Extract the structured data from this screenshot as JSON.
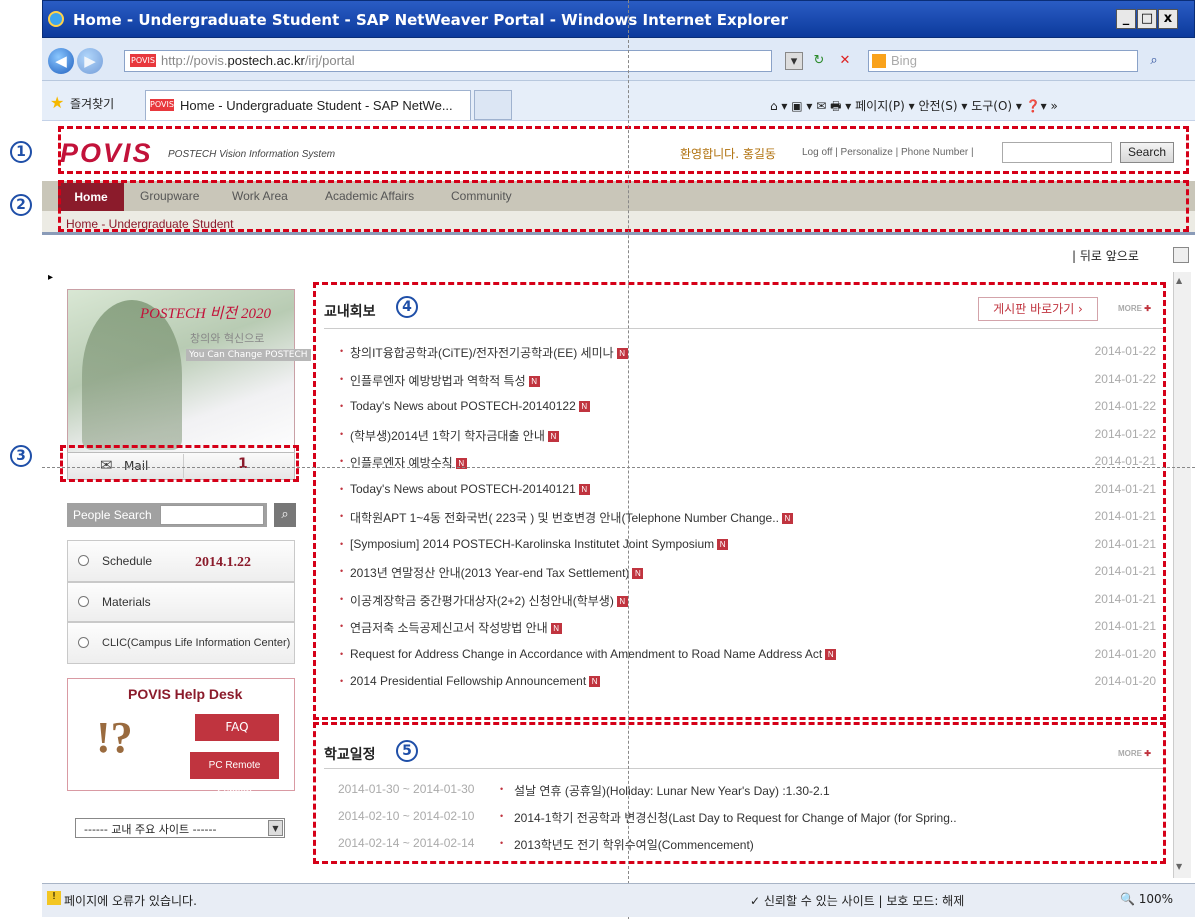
{
  "window": {
    "title": "Home - Undergraduate Student - SAP NetWeaver Portal - Windows Internet Explorer",
    "minimize": "_",
    "restore": "□",
    "close": "x"
  },
  "browser": {
    "back_glyph": "◀",
    "forward_glyph": "▶",
    "address_prefix": "http://povis.",
    "address_host": "postech.ac.kr",
    "address_suffix": "/irj/portal",
    "address_logo": "POVIS",
    "search_placeholder": "Bing",
    "favorites_label": "즐겨찾기",
    "tab_title": "Home - Undergraduate Student - SAP NetWe...",
    "command_bar": "⌂ ▾ ▣ ▾ ✉ 🖶 ▾  페이지(P) ▾  안전(S) ▾  도구(O) ▾  ❓▾ »",
    "back_forward": "| 뒤로  앞으로"
  },
  "portal": {
    "logo": "POVIS",
    "logo_sub": "POSTECH Vision Information System",
    "welcome": "환영합니다. 홍길동",
    "top_links": "Log off | Personalize | Phone Number |",
    "search_button": "Search",
    "nav": [
      "Home",
      "Groupware",
      "Work Area",
      "Academic Affairs",
      "Community"
    ],
    "breadcrumb": "Home - Undergraduate Student"
  },
  "left": {
    "banner_title": "POSTECH 비전 2020",
    "banner_sub": "창의와 혁신으로",
    "banner_en": "You Can Change POSTECH",
    "mail_label": "Mail",
    "mail_count": "1",
    "people_search": "People Search",
    "items": [
      "Schedule",
      "Materials",
      "CLIC(Campus Life Information Center)"
    ],
    "schedule_date": "2014.1.22",
    "helpdesk_title": "POVIS Help Desk",
    "faq": "FAQ",
    "pc_remote": "PC Remote Support",
    "site_select": "------ 교내 주요 사이트 ------"
  },
  "news": {
    "title": "교내회보",
    "board_button": "게시판 바로가기 ›",
    "more": "MORE",
    "items": [
      {
        "text": "창의IT융합공학과(CiTE)/전자전기공학과(EE) 세미나",
        "date": "2014-01-22"
      },
      {
        "text": "인플루엔자 예방방법과 역학적 특성",
        "date": "2014-01-22"
      },
      {
        "text": "Today's News about POSTECH-20140122",
        "date": "2014-01-22"
      },
      {
        "text": "(학부생)2014년 1학기 학자금대출 안내",
        "date": "2014-01-22"
      },
      {
        "text": "인플루엔자 예방수칙",
        "date": "2014-01-21"
      },
      {
        "text": "Today's News about POSTECH-20140121",
        "date": "2014-01-21"
      },
      {
        "text": "대학원APT 1~4동 전화국번( 223국 ) 및 번호변경 안내(Telephone Number Change..",
        "date": "2014-01-21"
      },
      {
        "text": "[Symposium] 2014 POSTECH-Karolinska Institutet Joint Symposium",
        "date": "2014-01-21"
      },
      {
        "text": "2013년 연말정산 안내(2013 Year-end Tax Settlement)",
        "date": "2014-01-21"
      },
      {
        "text": "이공계장학금 중간평가대상자(2+2) 신청안내(학부생)",
        "date": "2014-01-21"
      },
      {
        "text": "연금저축 소득공제신고서 작성방법 안내",
        "date": "2014-01-21"
      },
      {
        "text": "Request for Address Change in Accordance with Amendment to Road Name Address Act",
        "date": "2014-01-20"
      },
      {
        "text": "2014 Presidential Fellowship Announcement",
        "date": "2014-01-20"
      }
    ]
  },
  "schedule": {
    "title": "학교일정",
    "more": "MORE",
    "items": [
      {
        "dates": "2014-01-30 ~ 2014-01-30",
        "text": "설날 연휴 (공휴일)(Holiday: Lunar New Year's Day) :1.30-2.1"
      },
      {
        "dates": "2014-02-10 ~ 2014-02-10",
        "text": "2014-1학기 전공학과 변경신청(Last Day to Request for Change of Major (for Spring.."
      },
      {
        "dates": "2014-02-14 ~ 2014-02-14",
        "text": "2013학년도 전기 학위수여일(Commencement)"
      }
    ]
  },
  "annotations": [
    "1",
    "2",
    "3",
    "4",
    "5"
  ],
  "status": {
    "message": "페이지에 오류가 있습니다.",
    "trust": "✓ 신뢰할 수 있는 사이트 | 보호 모드: 해제",
    "zoom": "🔍 100%"
  },
  "colors": {
    "brand": "#c2123a",
    "nav_active": "#8b1b2b",
    "annotation_red": "#d50018",
    "annotation_blue": "#1f4fa8"
  }
}
